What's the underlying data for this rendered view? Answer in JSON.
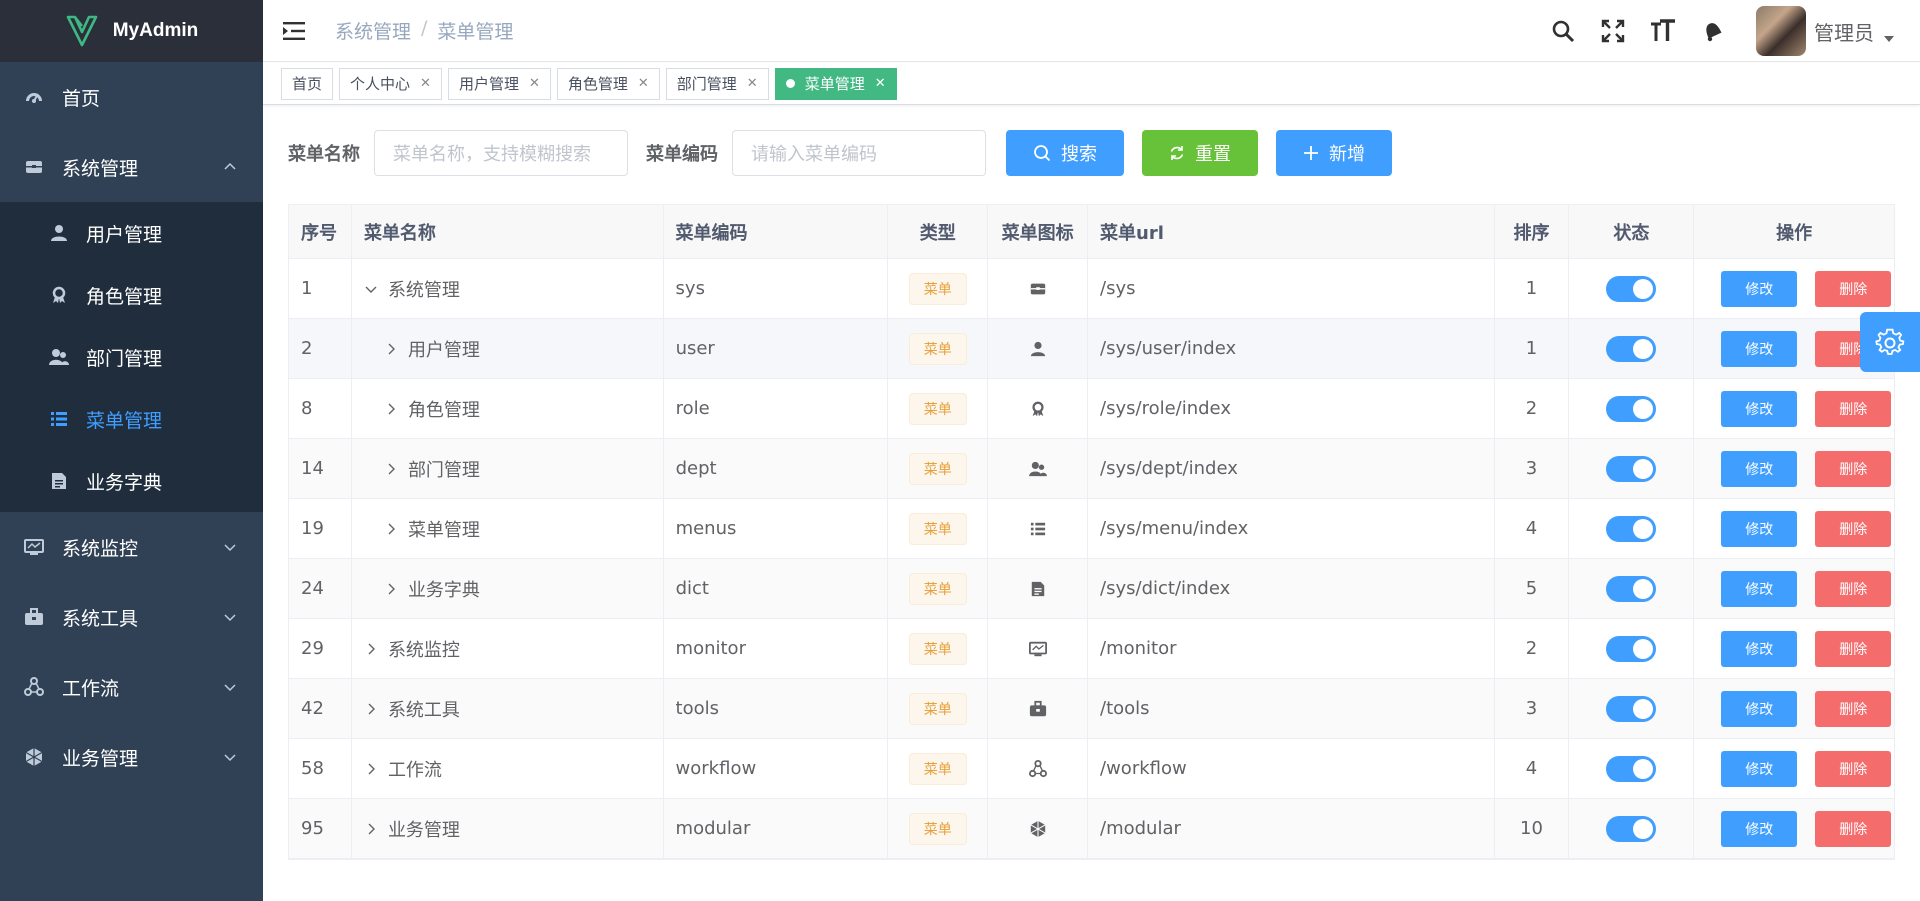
{
  "app": {
    "name": "MyAdmin"
  },
  "sidebar": {
    "items": [
      {
        "label": "首页",
        "icon": "dashboard-icon"
      },
      {
        "label": "系统管理",
        "icon": "system-icon",
        "expanded": true,
        "children": [
          {
            "label": "用户管理",
            "icon": "user-icon"
          },
          {
            "label": "角色管理",
            "icon": "role-icon"
          },
          {
            "label": "部门管理",
            "icon": "dept-icon"
          },
          {
            "label": "菜单管理",
            "icon": "menu-list-icon",
            "active": true
          },
          {
            "label": "业务字典",
            "icon": "dict-icon"
          }
        ]
      },
      {
        "label": "系统监控",
        "icon": "monitor-icon"
      },
      {
        "label": "系统工具",
        "icon": "tools-icon"
      },
      {
        "label": "工作流",
        "icon": "workflow-icon"
      },
      {
        "label": "业务管理",
        "icon": "modular-icon"
      }
    ]
  },
  "header": {
    "breadcrumb": [
      "系统管理",
      "菜单管理"
    ],
    "breadcrumb_separator": "/",
    "user_name": "管理员",
    "icons": [
      "search-icon",
      "fullscreen-icon",
      "font-size-icon",
      "bell-icon"
    ]
  },
  "tags": [
    {
      "label": "首页",
      "closable": false
    },
    {
      "label": "个人中心",
      "closable": true
    },
    {
      "label": "用户管理",
      "closable": true
    },
    {
      "label": "角色管理",
      "closable": true
    },
    {
      "label": "部门管理",
      "closable": true
    },
    {
      "label": "菜单管理",
      "closable": true,
      "active": true
    }
  ],
  "search": {
    "name_label": "菜单名称",
    "name_placeholder": "菜单名称，支持模糊搜索",
    "code_label": "菜单编码",
    "code_placeholder": "请输入菜单编码",
    "search_btn": "搜索",
    "reset_btn": "重置",
    "add_btn": "新增"
  },
  "table": {
    "columns": [
      "序号",
      "菜单名称",
      "菜单编码",
      "类型",
      "菜单图标",
      "菜单url",
      "排序",
      "状态",
      "操作"
    ],
    "edit_label": "修改",
    "delete_label": "删除",
    "rows": [
      {
        "id": "1",
        "name": "系统管理",
        "code": "sys",
        "type": "菜单",
        "icon": "system-icon",
        "url": "/sys",
        "sort": "1",
        "status": true,
        "level": 0,
        "expanded": true
      },
      {
        "id": "2",
        "name": "用户管理",
        "code": "user",
        "type": "菜单",
        "icon": "user-icon",
        "url": "/sys/user/index",
        "sort": "1",
        "status": true,
        "level": 1
      },
      {
        "id": "8",
        "name": "角色管理",
        "code": "role",
        "type": "菜单",
        "icon": "role-icon",
        "url": "/sys/role/index",
        "sort": "2",
        "status": true,
        "level": 1
      },
      {
        "id": "14",
        "name": "部门管理",
        "code": "dept",
        "type": "菜单",
        "icon": "dept-icon",
        "url": "/sys/dept/index",
        "sort": "3",
        "status": true,
        "level": 1
      },
      {
        "id": "19",
        "name": "菜单管理",
        "code": "menus",
        "type": "菜单",
        "icon": "menu-list-icon",
        "url": "/sys/menu/index",
        "sort": "4",
        "status": true,
        "level": 1
      },
      {
        "id": "24",
        "name": "业务字典",
        "code": "dict",
        "type": "菜单",
        "icon": "dict-icon",
        "url": "/sys/dict/index",
        "sort": "5",
        "status": true,
        "level": 1
      },
      {
        "id": "29",
        "name": "系统监控",
        "code": "monitor",
        "type": "菜单",
        "icon": "monitor-icon",
        "url": "/monitor",
        "sort": "2",
        "status": true,
        "level": 0
      },
      {
        "id": "42",
        "name": "系统工具",
        "code": "tools",
        "type": "菜单",
        "icon": "tools-icon",
        "url": "/tools",
        "sort": "3",
        "status": true,
        "level": 0
      },
      {
        "id": "58",
        "name": "工作流",
        "code": "workflow",
        "type": "菜单",
        "icon": "workflow-icon",
        "url": "/workflow",
        "sort": "4",
        "status": true,
        "level": 0
      },
      {
        "id": "95",
        "name": "业务管理",
        "code": "modular",
        "type": "菜单",
        "icon": "modular-icon",
        "url": "/modular",
        "sort": "10",
        "status": true,
        "level": 0
      }
    ]
  },
  "colors": {
    "sidebar_bg": "#304156",
    "submenu_bg": "#1f2d3d",
    "primary": "#409eff",
    "success": "#67c23a",
    "danger": "#f56c6c",
    "warning": "#e6a23c",
    "active_tag": "#42b983"
  }
}
